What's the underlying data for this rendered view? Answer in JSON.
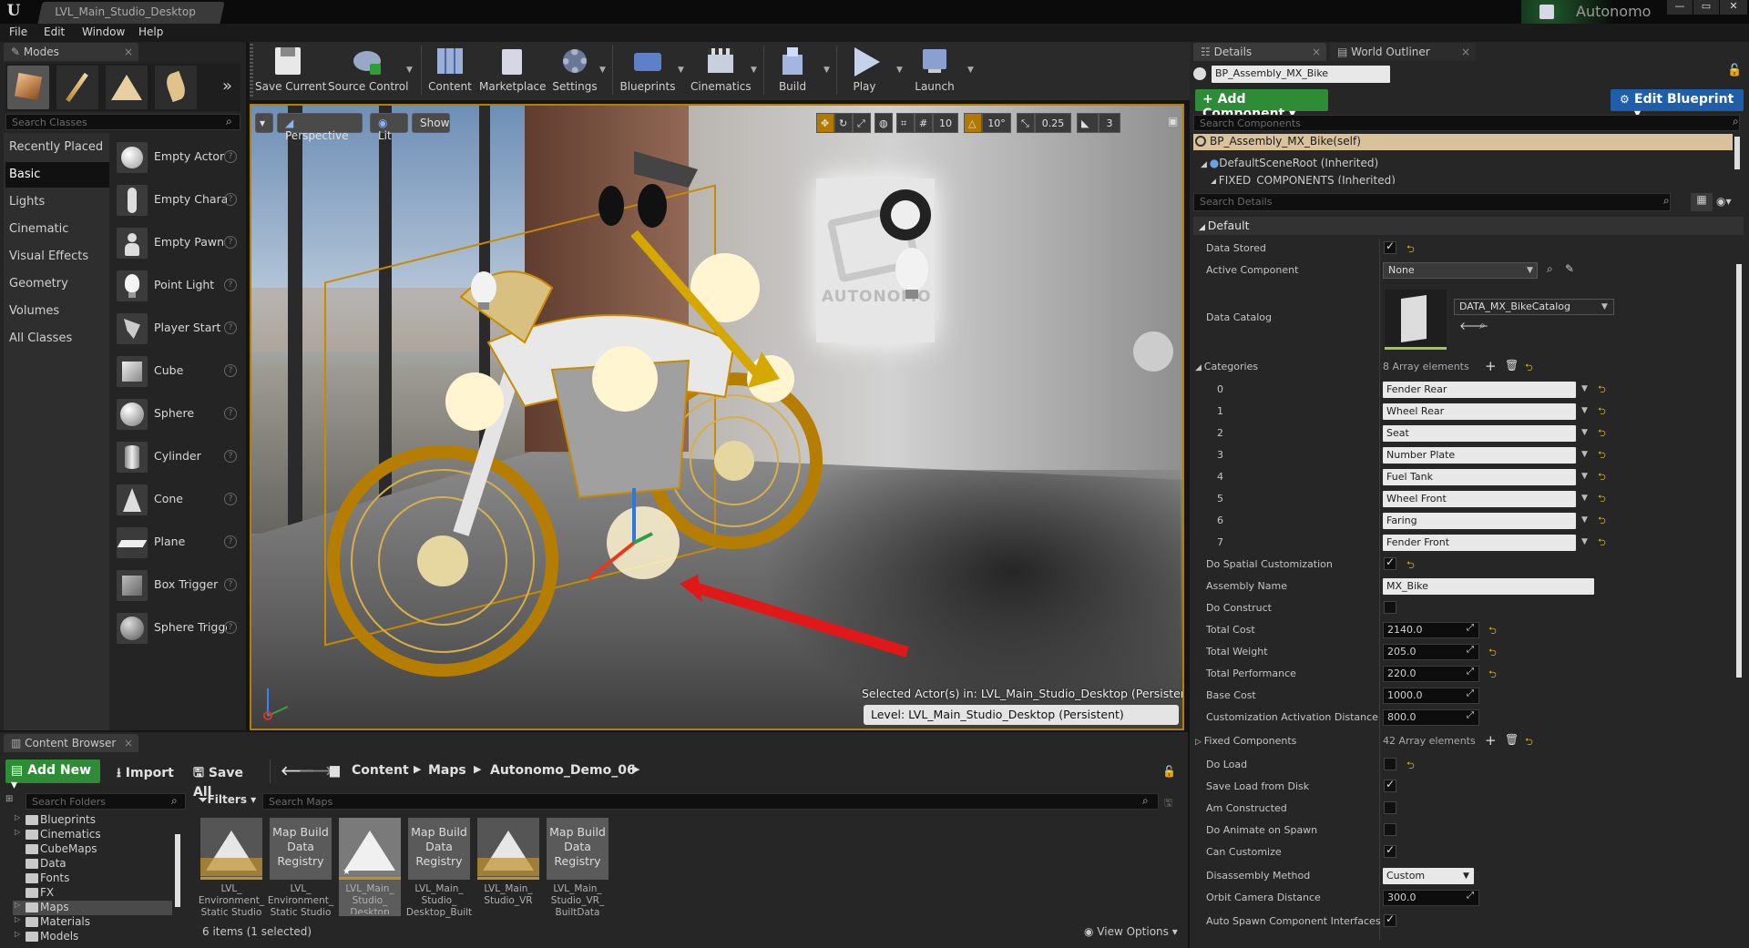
{
  "window": {
    "doc_tab": "LVL_Main_Studio_Desktop",
    "brand": "Autonomo",
    "min": "—",
    "max": "▭",
    "close": "✕"
  },
  "menu": [
    "File",
    "Edit",
    "Window",
    "Help"
  ],
  "modes": {
    "tab": "Modes",
    "search_placeholder": "Search Classes",
    "categories": [
      "Recently Placed",
      "Basic",
      "Lights",
      "Cinematic",
      "Visual Effects",
      "Geometry",
      "Volumes",
      "All Classes"
    ],
    "selected_category": "Basic",
    "items": [
      "Empty Actor",
      "Empty Character",
      "Empty Pawn",
      "Point Light",
      "Player Start",
      "Cube",
      "Sphere",
      "Cylinder",
      "Cone",
      "Plane",
      "Box Trigger",
      "Sphere Trigger"
    ]
  },
  "toolbar": {
    "buttons": [
      "Save Current",
      "Source Control",
      "Content",
      "Marketplace",
      "Settings",
      "Blueprints",
      "Cinematics",
      "Build",
      "Play",
      "Launch"
    ]
  },
  "viewport": {
    "perspective": "Perspective",
    "lit": "Lit",
    "show": "Show",
    "grid_snap": "10",
    "rot_snap": "10°",
    "scale_snap": "0.25",
    "cam_speed": "3",
    "selected_actor": "Selected Actor(s) in:  LVL_Main_Studio_Desktop (Persistent)",
    "level": "Level:  LVL_Main_Studio_Desktop (Persistent)",
    "sign_text": "AUTONOMO",
    "accent": "#c98a00",
    "x_axis_color": "#e01818",
    "y_axis_color": "#d4a800"
  },
  "details": {
    "tabs": [
      "Details",
      "World Outliner"
    ],
    "actor_name": "BP_Assembly_MX_Bike",
    "add_component": "+ Add Component ▾",
    "edit_blueprint": "Edit Blueprint ▾",
    "search_components": "Search Components",
    "components": [
      "BP_Assembly_MX_Bike(self)",
      "DefaultSceneRoot (Inherited)",
      "FIXED_COMPONENTS (Inherited)"
    ],
    "search_details": "Search Details",
    "section": "Default",
    "data_stored_label": "Data Stored",
    "active_component_label": "Active Component",
    "active_component_value": "None",
    "data_catalog_label": "Data Catalog",
    "data_catalog_value": "DATA_MX_BikeCatalog",
    "categories_label": "Categories",
    "categories_count": "8 Array elements",
    "categories": [
      {
        "i": "0",
        "v": "Fender Rear"
      },
      {
        "i": "1",
        "v": "Wheel Rear"
      },
      {
        "i": "2",
        "v": "Seat"
      },
      {
        "i": "3",
        "v": "Number Plate"
      },
      {
        "i": "4",
        "v": "Fuel Tank"
      },
      {
        "i": "5",
        "v": "Wheel Front"
      },
      {
        "i": "6",
        "v": "Faring"
      },
      {
        "i": "7",
        "v": "Fender Front"
      }
    ],
    "do_spatial": "Do Spatial Customization",
    "assembly_name_label": "Assembly Name",
    "assembly_name_value": "MX_Bike",
    "do_construct": "Do Construct",
    "total_cost_label": "Total Cost",
    "total_cost": "2140.0",
    "total_weight_label": "Total Weight",
    "total_weight": "205.0",
    "total_perf_label": "Total Performance",
    "total_perf": "220.0",
    "base_cost_label": "Base Cost",
    "base_cost": "1000.0",
    "cust_dist_label": "Customization Activation Distance",
    "cust_dist": "800.0",
    "fixed_components_label": "Fixed Components",
    "fixed_components_count": "42 Array elements",
    "do_load": "Do Load",
    "save_load": "Save Load from Disk",
    "am_constructed": "Am Constructed",
    "do_animate": "Do Animate on Spawn",
    "can_customize": "Can Customize",
    "disassembly_label": "Disassembly Method",
    "disassembly_value": "Custom",
    "orbit_label": "Orbit Camera Distance",
    "orbit_value": "300.0",
    "auto_spawn": "Auto Spawn Component Interfaces"
  },
  "content_browser": {
    "tab": "Content Browser",
    "add_new": "Add New ▾",
    "import": "Import",
    "save_all": "Save All",
    "path": [
      "Content",
      "Maps",
      "Autonomo_Demo_06"
    ],
    "search_folders": "Search Folders",
    "filters": "Filters ▾",
    "search_maps": "Search Maps",
    "folders": [
      "Blueprints",
      "Cinematics",
      "CubeMaps",
      "Data",
      "Fonts",
      "FX",
      "Maps",
      "Materials",
      "Models"
    ],
    "selected_folder": "Maps",
    "assets": [
      {
        "kind": "map",
        "name": "LVL_\nEnvironment_\nStatic Studio"
      },
      {
        "kind": "registry",
        "label": "Map Build Data Registry",
        "name": "LVL_\nEnvironment_\nStatic Studio"
      },
      {
        "kind": "map",
        "name": "LVL_Main_\nStudio_\nDesktop"
      },
      {
        "kind": "registry",
        "label": "Map Build Data Registry",
        "name": "LVL_Main_\nStudio_\nDesktop_Built"
      },
      {
        "kind": "map",
        "name": "LVL_Main_\nStudio_VR"
      },
      {
        "kind": "registry",
        "label": "Map Build Data Registry",
        "name": "LVL_Main_\nStudio_VR_\nBuiltData"
      }
    ],
    "status": "6 items (1 selected)",
    "view_options": "View Options ▾"
  }
}
